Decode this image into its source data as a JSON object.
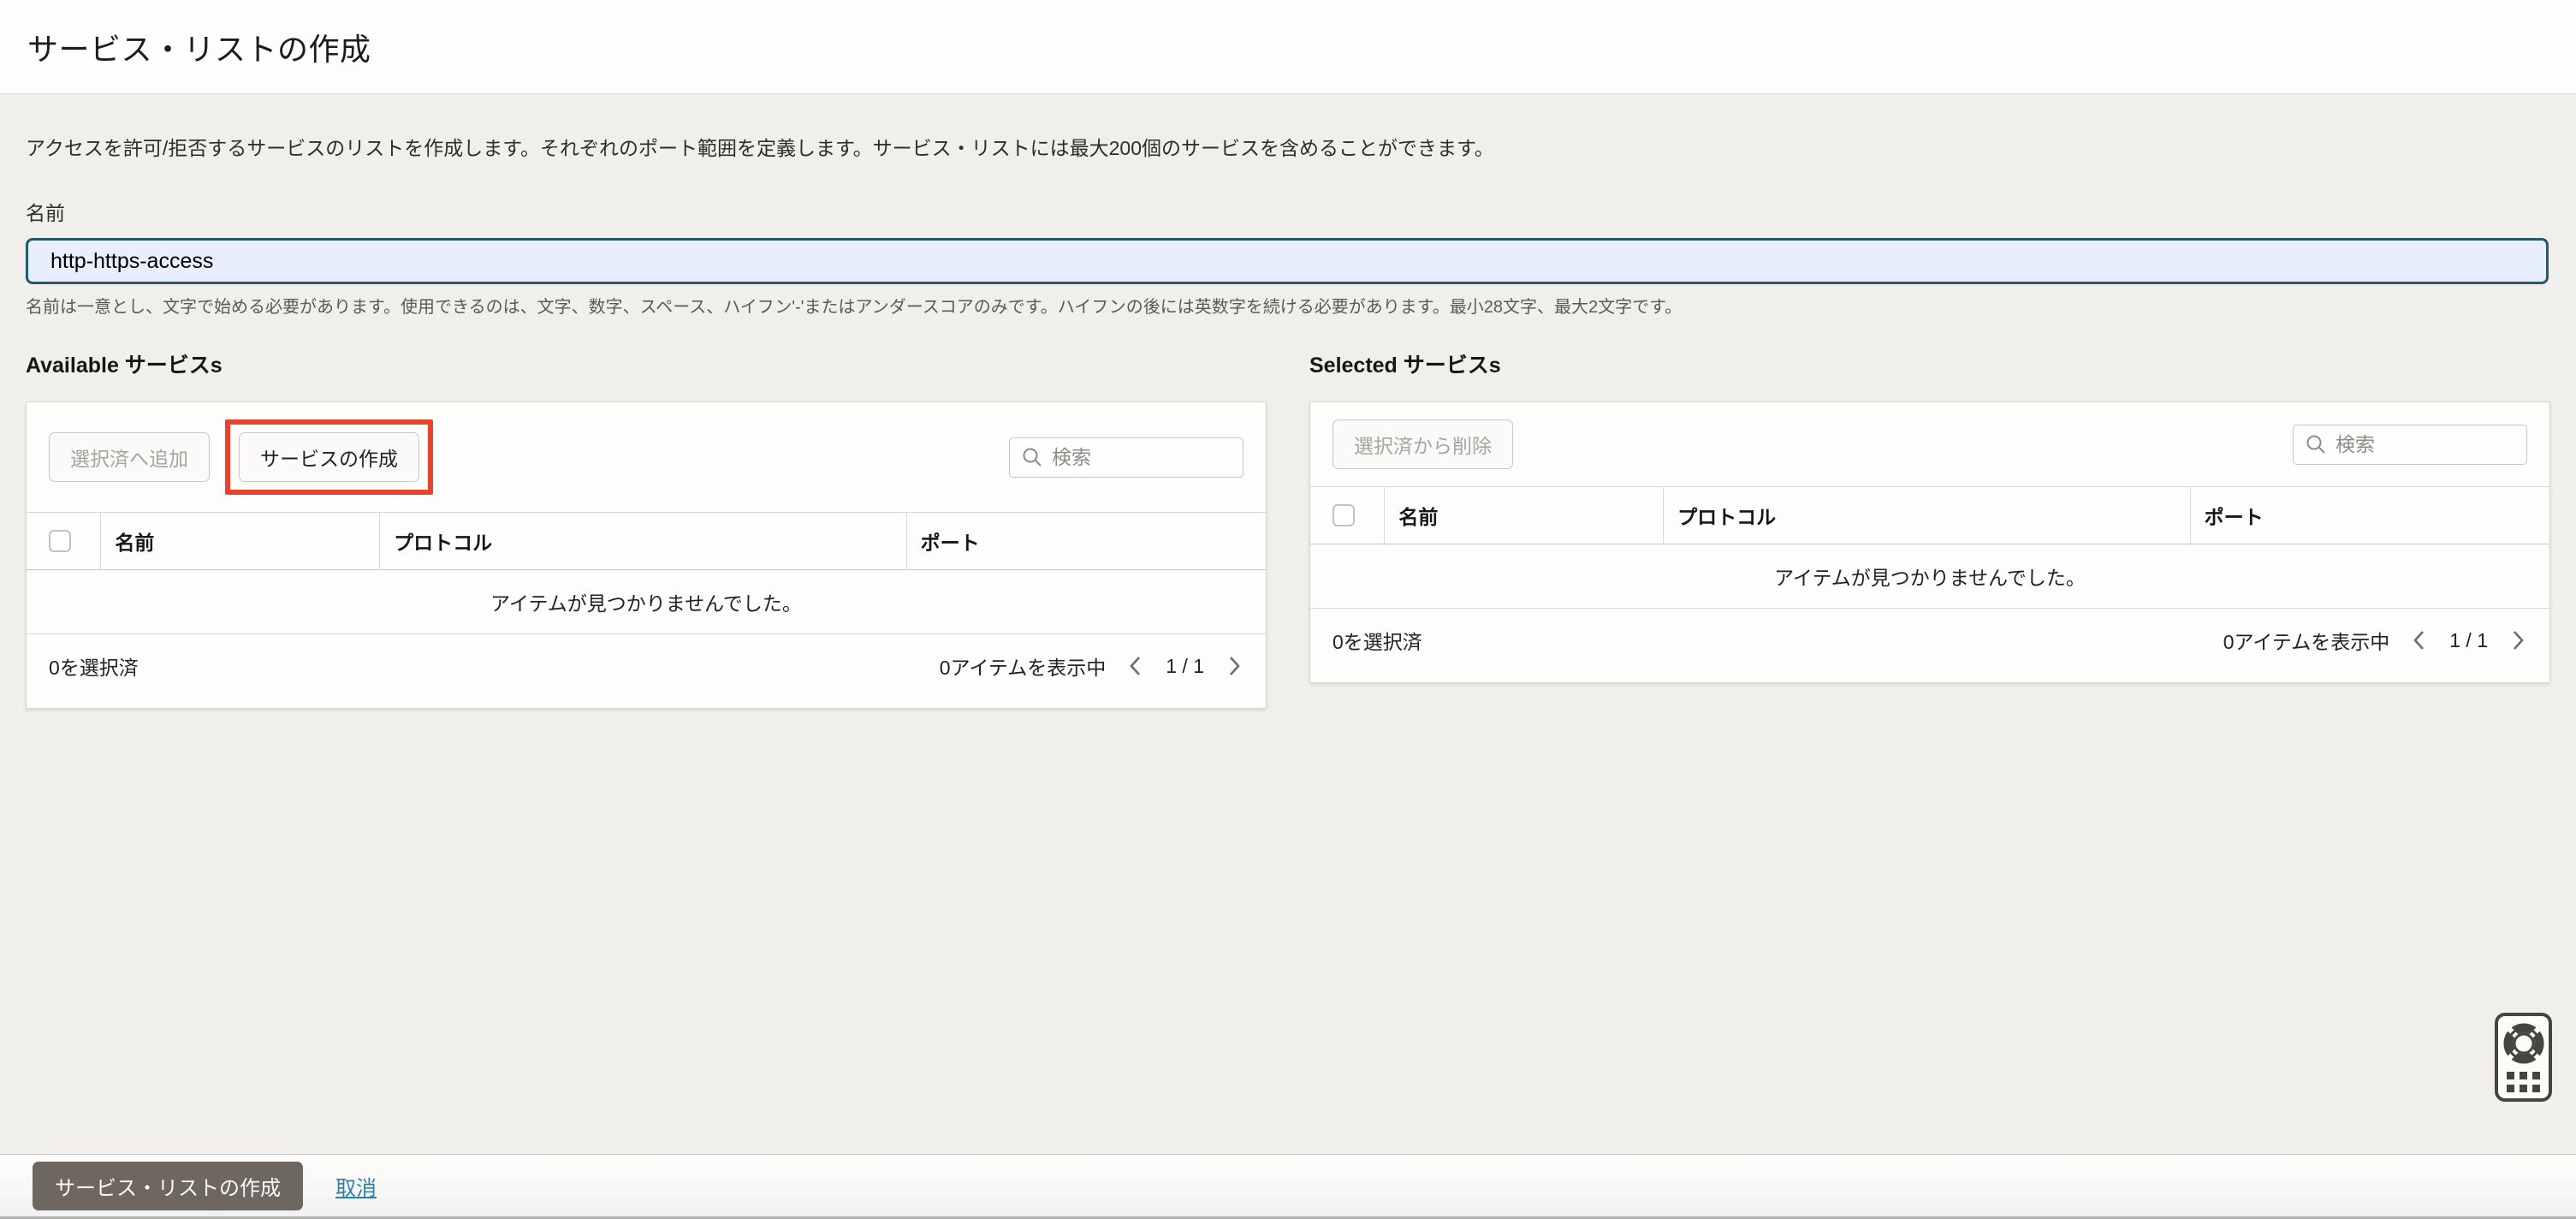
{
  "page": {
    "title": "サービス・リストの作成"
  },
  "intro": {
    "description": "アクセスを許可/拒否するサービスのリストを作成します。それぞれのポート範囲を定義します。サービス・リストには最大200個のサービスを含めることができます。",
    "name_label": "名前",
    "name_value": "http-https-access",
    "name_help": "名前は一意とし、文字で始める必要があります。使用できるのは、文字、数字、スペース、ハイフン'-'またはアンダースコアのみです。ハイフンの後には英数字を続ける必要があります。最小28文字、最大2文字です。"
  },
  "available": {
    "heading": "Available サービスs",
    "add_button": "選択済へ追加",
    "create_button": "サービスの作成",
    "search_placeholder": "検索",
    "columns": {
      "name": "名前",
      "protocol": "プロトコル",
      "port": "ポート"
    },
    "empty_message": "アイテムが見つかりませんでした。",
    "selected_count": "0を選択済",
    "showing_count": "0アイテムを表示中",
    "page_indicator": "1 / 1"
  },
  "selected": {
    "heading": "Selected サービスs",
    "remove_button": "選択済から削除",
    "search_placeholder": "検索",
    "columns": {
      "name": "名前",
      "protocol": "プロトコル",
      "port": "ポート"
    },
    "empty_message": "アイテムが見つかりませんでした。",
    "selected_count": "0を選択済",
    "showing_count": "0アイテムを表示中",
    "page_indicator": "1 / 1"
  },
  "footer": {
    "create_label": "サービス・リストの作成",
    "cancel_label": "取消"
  },
  "colors": {
    "focused_input_border": "#26586f",
    "focused_input_bg": "#e8eefb",
    "annotation_red": "#e8432e",
    "primary_button_bg": "#6e675f",
    "link_blue": "#2e7fa8",
    "page_bg": "#f1efec"
  }
}
